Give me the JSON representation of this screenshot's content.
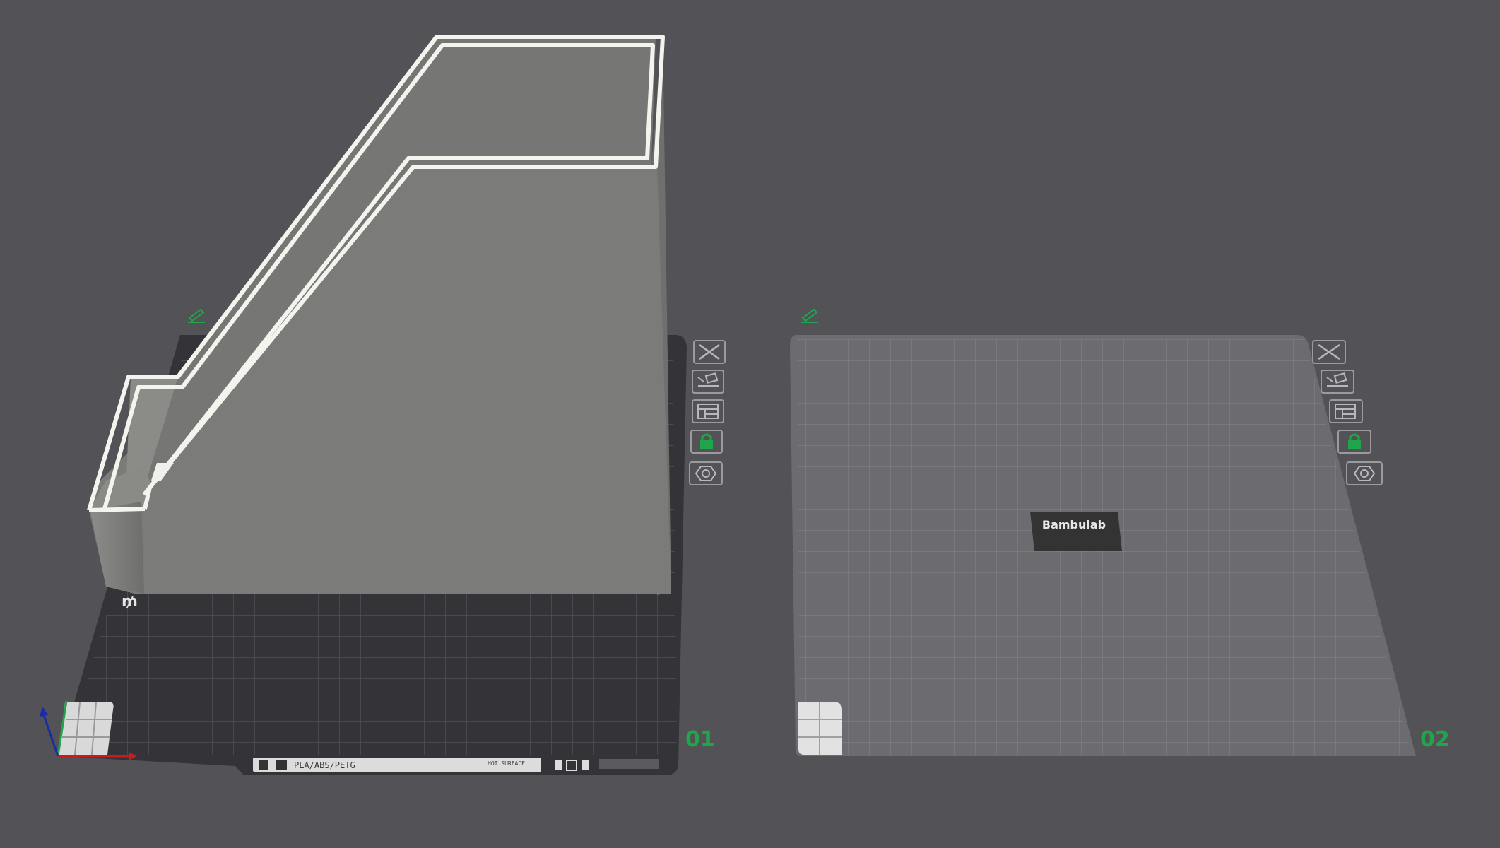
{
  "plates": [
    {
      "label": "01",
      "bed_style": "textured-dark",
      "bed_strip_text": "PLA/ABS/PETG",
      "bed_strip_small": "HOT SURFACE",
      "has_model": true
    },
    {
      "label": "02",
      "bed_style": "smooth-grey",
      "logo_text": "Bambulab",
      "has_model": false
    }
  ],
  "plate_buttons": [
    {
      "name": "delete-plate",
      "icon": "close-icon"
    },
    {
      "name": "arrange",
      "icon": "arrange-icon"
    },
    {
      "name": "orient",
      "icon": "orient-icon"
    },
    {
      "name": "lock-plate",
      "icon": "lock-icon"
    },
    {
      "name": "plate-settings",
      "icon": "settings-icon"
    }
  ],
  "colors": {
    "background": "#525257",
    "accent_green": "#1fa64a",
    "model_face": "#7b7b7a",
    "model_rim": "#f4f4ef"
  },
  "axes": {
    "x": "red",
    "y": "green",
    "z": "blue"
  }
}
